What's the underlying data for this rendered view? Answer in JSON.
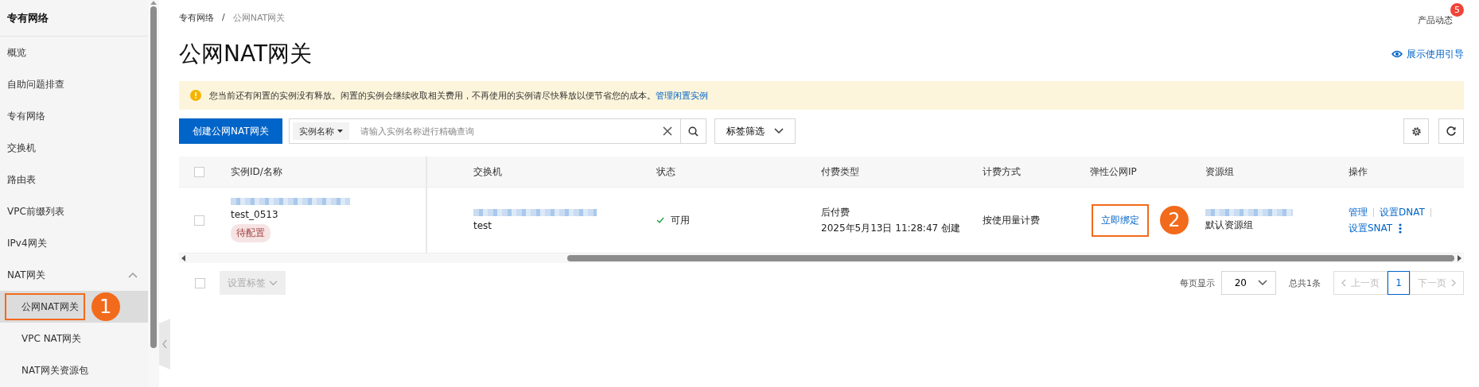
{
  "sidebar": {
    "title": "专有网络",
    "items": [
      {
        "label": "概览"
      },
      {
        "label": "自助问题排查"
      },
      {
        "label": "专有网络"
      },
      {
        "label": "交换机"
      },
      {
        "label": "路由表"
      },
      {
        "label": "VPC前缀列表"
      },
      {
        "label": "IPv4网关"
      },
      {
        "label": "NAT网关",
        "expanded": true,
        "children": [
          {
            "label": "公网NAT网关",
            "selected": true,
            "callout": "1"
          },
          {
            "label": "VPC NAT网关",
            "selected": false
          },
          {
            "label": "NAT网关资源包",
            "selected": false
          }
        ]
      }
    ]
  },
  "breadcrumb": [
    "专有网络",
    "公网NAT网关"
  ],
  "breadcrumb_separator": "/",
  "page_title": "公网NAT网关",
  "product_news": {
    "label": "产品动态",
    "badge": "5"
  },
  "guide_link": "展示使用引导",
  "alert": {
    "message": "您当前还有闲置的实例没有释放。闲置的实例会继续收取相关费用，不再使用的实例请尽快释放以便节省您的成本。",
    "link": "管理闲置实例"
  },
  "toolbar": {
    "create_button": "创建公网NAT网关",
    "search_by": "实例名称",
    "search": {
      "placeholder": "请输入实例名称进行精确查询"
    },
    "tag_filter": "标签筛选"
  },
  "table": {
    "columns": [
      "实例ID/名称",
      "交换机",
      "状态",
      "付费类型",
      "计费方式",
      "弹性公网IP",
      "资源组",
      "操作"
    ],
    "header_checked": false,
    "rows": [
      {
        "checked": false,
        "name": "test_0513",
        "tag": "待配置",
        "switch": "test",
        "status": {
          "kind": "ok",
          "label": "可用"
        },
        "payment": "后付费",
        "created": "2025年5月13日 11:28:47 创建",
        "billing": "按使用量计费",
        "eip": {
          "link": "立即绑定",
          "callout": "2"
        },
        "resource_group": "默认资源组",
        "actions": [
          "管理",
          "设置DNAT",
          "设置SNAT"
        ]
      }
    ]
  },
  "footer": {
    "checked": false,
    "tag_button": {
      "label": "设置标签",
      "disabled": true
    },
    "page_size_label": "每页显示",
    "page_size": "20",
    "total": "总共1条",
    "prev": {
      "label": "上一页",
      "disabled": true
    },
    "next": {
      "label": "下一页",
      "disabled": true
    },
    "pages": [
      {
        "label": "1",
        "selected": true
      }
    ]
  }
}
